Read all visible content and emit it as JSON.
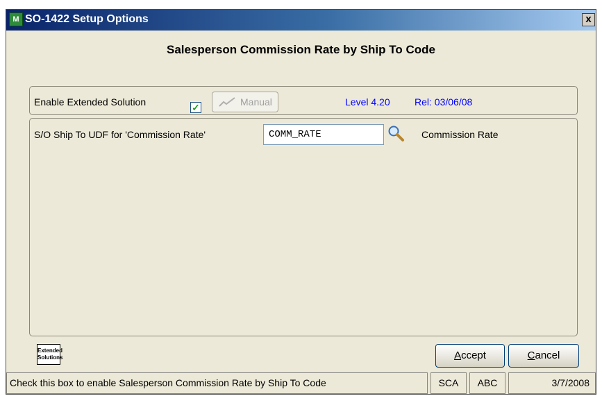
{
  "window": {
    "title": "SO-1422 Setup Options",
    "icon": "mas-app-icon",
    "close_label": "x"
  },
  "heading": "Salesperson Commission Rate by Ship To Code",
  "top_panel": {
    "enable_label": "Enable Extended Solution",
    "enable_checked": true,
    "manual_button": "Manual",
    "level": "Level 4.20",
    "release": "Rel: 03/06/08"
  },
  "main_panel": {
    "udf_label": "S/O Ship To UDF for 'Commission Rate'",
    "udf_value": "COMM_RATE",
    "udf_description": "Commission Rate"
  },
  "logo": {
    "line1": "Extended",
    "line2": "Solutions"
  },
  "buttons": {
    "accept_first": "A",
    "accept_rest": "ccept",
    "cancel_first": "C",
    "cancel_rest": "ancel"
  },
  "statusbar": {
    "message": "Check this box to enable Salesperson Commission Rate by Ship To Code",
    "company": "SCA",
    "user": "ABC",
    "date": "3/7/2008"
  },
  "colors": {
    "title_bar_start": "#0a246a",
    "title_bar_end": "#a6caf0",
    "level_text": "#0000ff",
    "window_face": "#ece9d8"
  }
}
